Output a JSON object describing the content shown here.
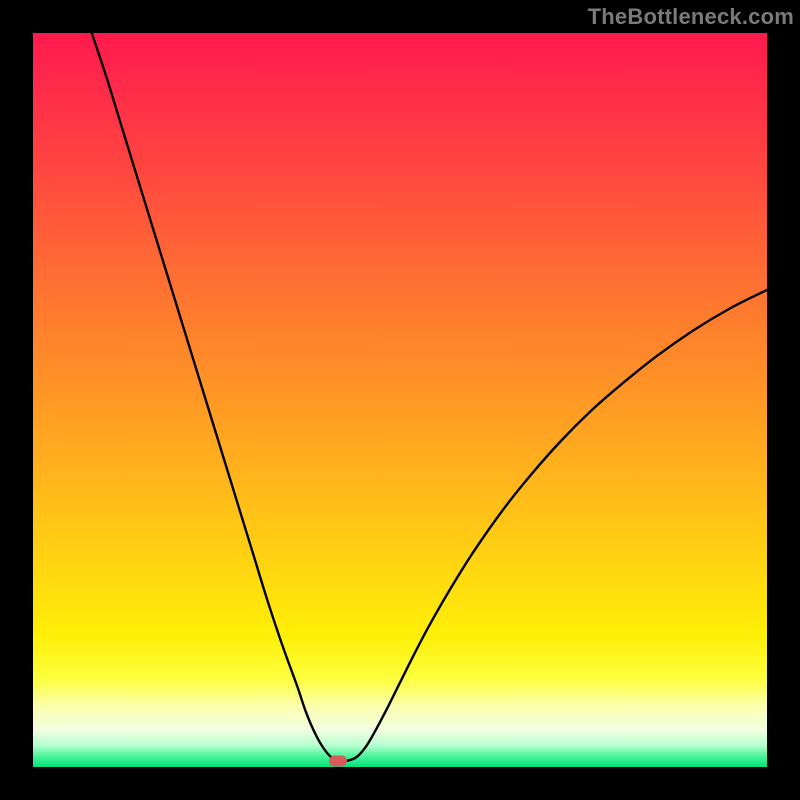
{
  "watermark": "TheBottleneck.com",
  "marker": {
    "x_frac": 0.415,
    "y_frac": 0.992
  },
  "colors": {
    "background": "#000000",
    "curve": "#000000",
    "marker": "#d85a5a",
    "watermark": "#7a7a7a"
  },
  "chart_data": {
    "type": "line",
    "title": "",
    "xlabel": "",
    "ylabel": "",
    "xlim": [
      0,
      100
    ],
    "ylim": [
      0,
      100
    ],
    "grid": false,
    "legend": false,
    "series": [
      {
        "name": "bottleneck-curve",
        "x": [
          8,
          10,
          12,
          14,
          16,
          18,
          20,
          22,
          24,
          26,
          28,
          30,
          32,
          34,
          36,
          37,
          38,
          39,
          40,
          41,
          41.5,
          42,
          43,
          44,
          45,
          46,
          48,
          50,
          52,
          54,
          57,
          60,
          64,
          68,
          72,
          76,
          80,
          85,
          90,
          95,
          100
        ],
        "y": [
          100,
          94,
          87.5,
          81,
          74.5,
          68,
          61.5,
          55,
          48.5,
          42,
          35.5,
          29,
          22.5,
          16.5,
          11,
          8,
          5.5,
          3.5,
          2,
          1,
          0.7,
          0.7,
          0.9,
          1.3,
          2.3,
          3.8,
          7.5,
          11.5,
          15.5,
          19.3,
          24.5,
          29.3,
          35,
          40,
          44.5,
          48.5,
          52,
          56,
          59.5,
          62.5,
          65
        ]
      }
    ],
    "annotations": [
      {
        "type": "marker",
        "x": 41.5,
        "y": 0.8,
        "label": "optimal-point"
      }
    ]
  }
}
